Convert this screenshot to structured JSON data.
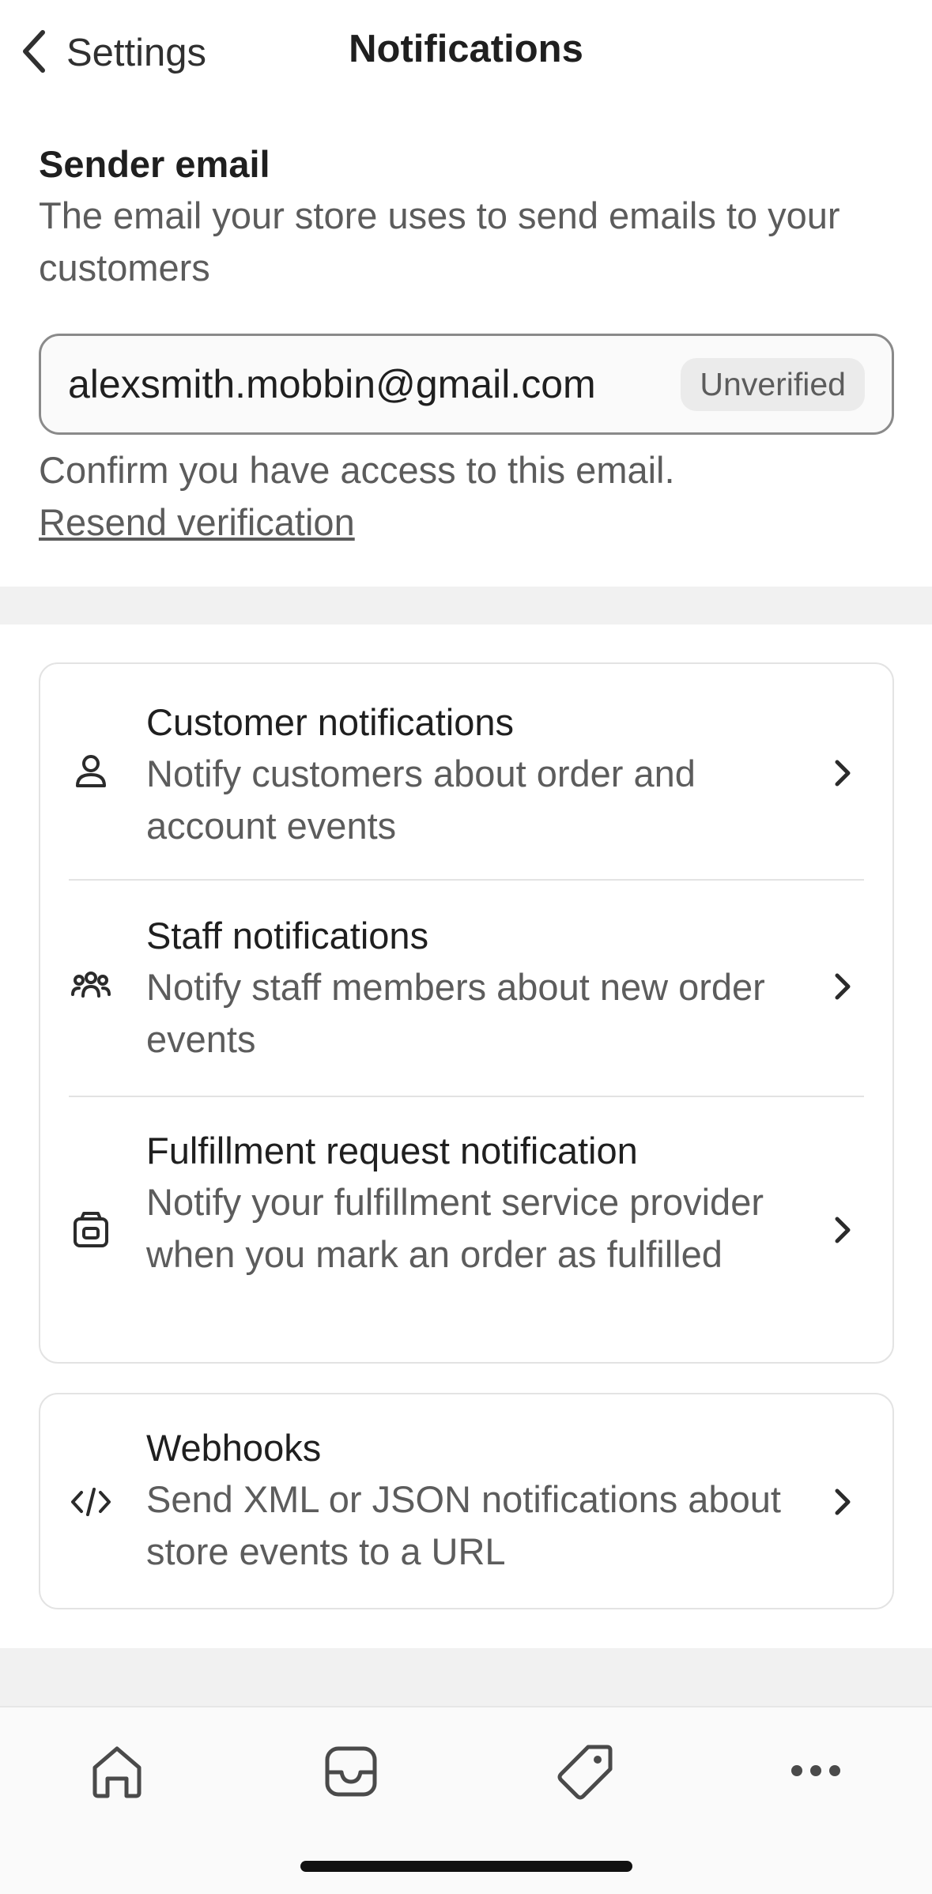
{
  "header": {
    "back_label": "Settings",
    "title": "Notifications"
  },
  "sender": {
    "heading": "Sender email",
    "description": "The email your store uses to send emails to your customers",
    "email_value": "alexsmith.mobbin@gmail.com",
    "badge": "Unverified",
    "confirm_text": "Confirm you have access to this email.",
    "resend_link": "Resend verification"
  },
  "notification_rows": [
    {
      "title": "Customer notifications",
      "description": "Notify customers about order and account events",
      "icon": "person-icon"
    },
    {
      "title": "Staff notifications",
      "description": "Notify staff members about new order events",
      "icon": "staff-group-icon"
    },
    {
      "title": "Fulfillment request notification",
      "description": "Notify your fulfillment service provider when you mark an order as fulfilled",
      "icon": "store-box-icon"
    }
  ],
  "webhooks_row": {
    "title": "Webhooks",
    "description": "Send XML or JSON notifications about store events to a URL",
    "icon": "code-icon"
  },
  "tabbar": {
    "tabs": [
      "home-icon",
      "inbox-icon",
      "tag-icon",
      "more-icon"
    ]
  },
  "colors": {
    "text_primary": "#1f1f1f",
    "text_secondary": "#5c5c5c",
    "border": "#e3e3e3",
    "band": "#f1f1f1"
  }
}
